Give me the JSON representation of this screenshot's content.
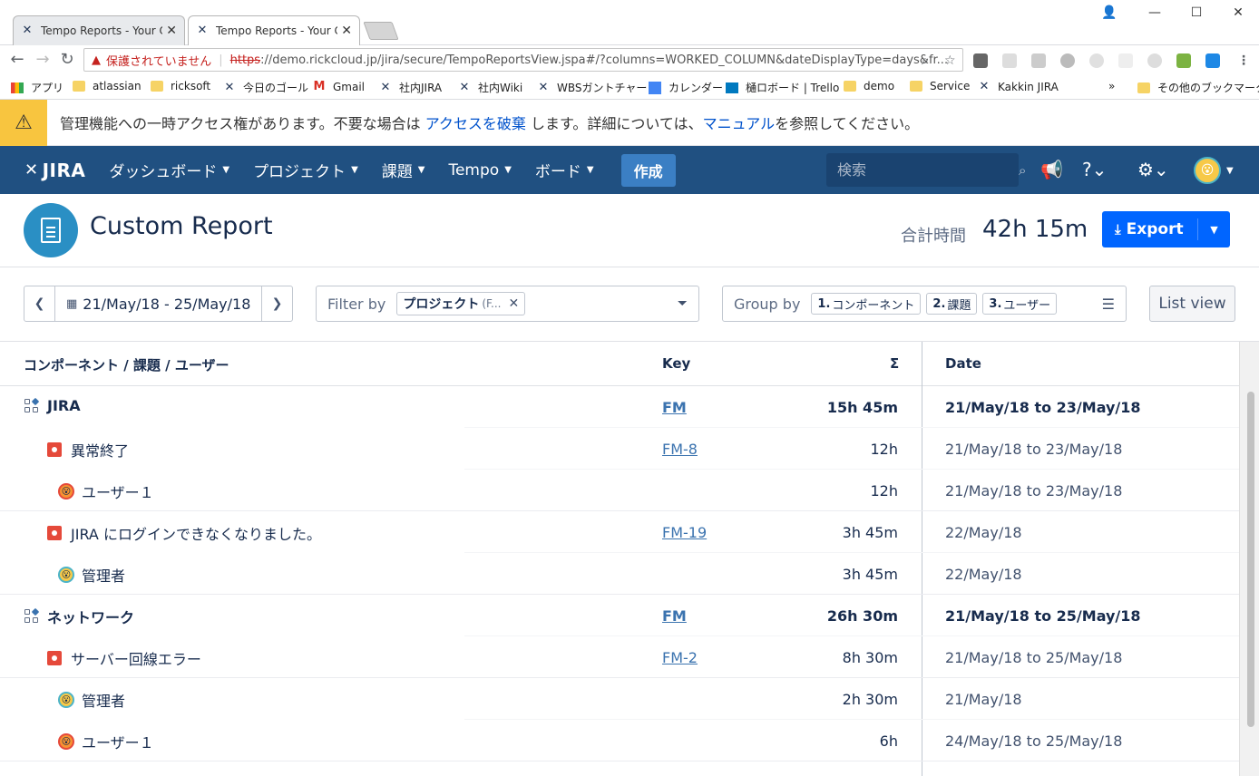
{
  "browser": {
    "tabs": [
      {
        "title": "Tempo Reports - Your Co"
      },
      {
        "title": "Tempo Reports - Your Co"
      }
    ],
    "omnibox": {
      "insecure_label": "保護されていません",
      "scheme": "https",
      "url_rest": "://demo.rickcloud.jp/jira/secure/TempoReportsView.jspa#/?columns=WORKED_COLUMN&dateDisplayType=days&fr..."
    },
    "bookmarks": [
      "アプリ",
      "atlassian",
      "ricksoft",
      "今日のゴール",
      "Gmail",
      "社内JIRA",
      "社内Wiki",
      "WBSガントチャート",
      "カレンダー",
      "樋ロボード | Trello",
      "demo",
      "Service",
      "Kakkin JIRA"
    ],
    "bookmarks_more": "»",
    "other_bookmarks": "その他のブックマーク"
  },
  "banner": {
    "text_before": "管理機能への一時アクセス権があります。不要な場合は ",
    "link1": "アクセスを破棄",
    "text_middle": " します。詳細については、",
    "link2": "マニュアル",
    "text_after": "を参照してください。"
  },
  "header": {
    "logo": "JIRA",
    "nav": [
      {
        "label": "ダッシュボード"
      },
      {
        "label": "プロジェクト"
      },
      {
        "label": "課題"
      },
      {
        "label": "Tempo"
      },
      {
        "label": "ボード"
      }
    ],
    "create_label": "作成",
    "search_placeholder": "検索"
  },
  "page": {
    "title": "Custom Report",
    "total_label": "合計時間",
    "total_value": "42h 15m",
    "export_label": "Export"
  },
  "controls": {
    "date_range": "21/May/18 - 25/May/18",
    "filter_label": "Filter by",
    "filter_chip": "プロジェクト",
    "filter_chip_detail": "(F...",
    "groupby_label": "Group by",
    "groups": [
      {
        "num": "1.",
        "label": "コンポーネント"
      },
      {
        "num": "2.",
        "label": "課題"
      },
      {
        "num": "3.",
        "label": "ユーザー"
      }
    ],
    "listview_label": "List view"
  },
  "table": {
    "headers": {
      "name": "コンポーネント / 課題 / ユーザー",
      "key": "Key",
      "sum": "Σ",
      "date": "Date"
    },
    "rows": [
      {
        "level": "comp",
        "name": "JIRA",
        "key": "FM",
        "sum": "15h 45m",
        "date": "21/May/18 to 23/May/18"
      },
      {
        "level": "issue",
        "name": "異常終了",
        "key": "FM-8",
        "sum": "12h",
        "date": "21/May/18 to 23/May/18"
      },
      {
        "level": "user",
        "name": "ユーザー１",
        "key": "",
        "sum": "12h",
        "date": "21/May/18 to 23/May/18",
        "avatar": "orange"
      },
      {
        "level": "issue",
        "name": "JIRA にログインできなくなりました。",
        "key": "FM-19",
        "sum": "3h 45m",
        "date": "22/May/18"
      },
      {
        "level": "user",
        "name": "管理者",
        "key": "",
        "sum": "3h 45m",
        "date": "22/May/18",
        "avatar": "teal"
      },
      {
        "level": "comp",
        "name": "ネットワーク",
        "key": "FM",
        "sum": "26h 30m",
        "date": "21/May/18 to 25/May/18"
      },
      {
        "level": "issue",
        "name": "サーバー回線エラー",
        "key": "FM-2",
        "sum": "8h 30m",
        "date": "21/May/18 to 25/May/18"
      },
      {
        "level": "user",
        "name": "管理者",
        "key": "",
        "sum": "2h 30m",
        "date": "21/May/18",
        "avatar": "teal"
      },
      {
        "level": "user",
        "name": "ユーザー１",
        "key": "",
        "sum": "6h",
        "date": "24/May/18 to 25/May/18",
        "avatar": "orange"
      }
    ]
  }
}
